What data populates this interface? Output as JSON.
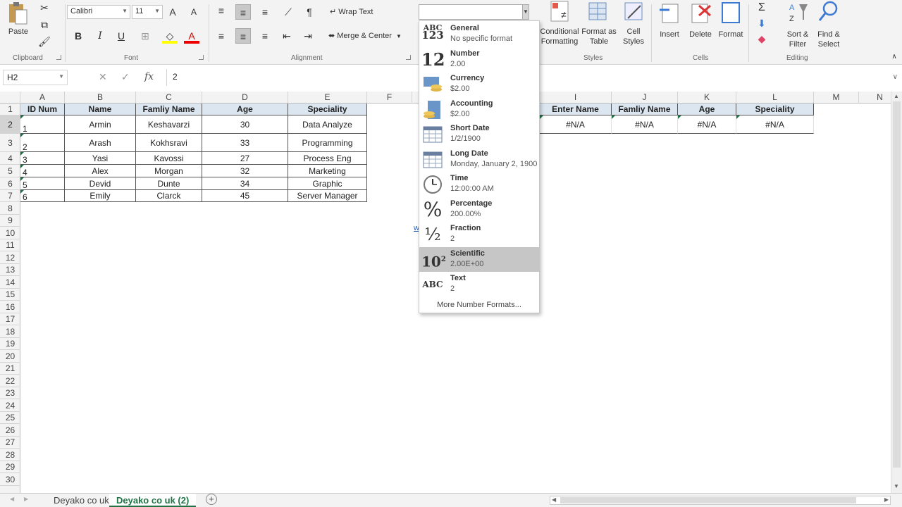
{
  "ribbon": {
    "clipboard": {
      "paste": "Paste",
      "label": "Clipboard"
    },
    "font": {
      "name": "Calibri",
      "size": "11",
      "label": "Font",
      "bold": "B",
      "italic": "I",
      "underline": "U",
      "grow": "A",
      "shrink": "A",
      "font_color_glyph": "A"
    },
    "alignment": {
      "wrap_text": "Wrap Text",
      "merge_center": "Merge & Center",
      "label": "Alignment"
    },
    "styles": {
      "conditional": "Conditional",
      "formatting": "Formatting",
      "format_as": "Format as",
      "table": "Table",
      "cell": "Cell",
      "cell_styles": "Styles",
      "label": "Styles"
    },
    "cells": {
      "insert": "Insert",
      "delete": "Delete",
      "format": "Format",
      "label": "Cells"
    },
    "editing": {
      "sort": "Sort &",
      "filter": "Filter",
      "find": "Find &",
      "select": "Select",
      "label": "Editing",
      "sigma": "Σ"
    }
  },
  "formula_bar": {
    "name_box": "H2",
    "fx": "fx",
    "value": "2"
  },
  "columns": [
    {
      "id": "A"
    },
    {
      "id": "B"
    },
    {
      "id": "C"
    },
    {
      "id": "D"
    },
    {
      "id": "E"
    },
    {
      "id": "F"
    },
    {
      "id": "I"
    },
    {
      "id": "J"
    },
    {
      "id": "K"
    },
    {
      "id": "L"
    },
    {
      "id": "M"
    },
    {
      "id": "N"
    }
  ],
  "rows": [
    "1",
    "2",
    "3",
    "4",
    "5",
    "6",
    "7",
    "8",
    "9",
    "10",
    "11",
    "12",
    "13",
    "14",
    "15",
    "16",
    "17",
    "18",
    "19",
    "20",
    "21",
    "22",
    "23",
    "24",
    "25",
    "26",
    "27",
    "28",
    "29",
    "30"
  ],
  "table": {
    "headers": [
      "ID Num",
      "Name",
      "Famliy Name",
      "Age",
      "Speciality"
    ],
    "rows": [
      [
        "1",
        "Armin",
        "Keshavarzi",
        "30",
        "Data Analyze"
      ],
      [
        "2",
        "Arash",
        "Kokhsravi",
        "33",
        "Programming"
      ],
      [
        "3",
        "Yasi",
        "Kavossi",
        "27",
        "Process Eng"
      ],
      [
        "4",
        "Alex",
        "Morgan",
        "32",
        "Marketing"
      ],
      [
        "5",
        "Devid",
        "Dunte",
        "34",
        "Graphic"
      ],
      [
        "6",
        "Emily",
        "Clarck",
        "45",
        "Server Manager"
      ]
    ]
  },
  "lookup": {
    "headers": [
      "Enter Name",
      "Famliy Name",
      "Age",
      "Speciality"
    ],
    "values": [
      "#N/A",
      "#N/A",
      "#N/A",
      "#N/A"
    ]
  },
  "partial_link": "w",
  "number_format_dropdown": {
    "items": [
      {
        "name": "General",
        "example": "No specific format",
        "icon": "abc-123-icon"
      },
      {
        "name": "Number",
        "example": "2.00",
        "icon": "number-12-icon"
      },
      {
        "name": "Currency",
        "example": "$2.00",
        "icon": "currency-icon"
      },
      {
        "name": "Accounting",
        "example": " $2.00",
        "icon": "accounting-icon"
      },
      {
        "name": "Short Date",
        "example": "1/2/1900",
        "icon": "calendar-icon"
      },
      {
        "name": "Long Date",
        "example": "Monday, January 2, 1900",
        "icon": "calendar-icon"
      },
      {
        "name": "Time",
        "example": "12:00:00 AM",
        "icon": "clock-icon"
      },
      {
        "name": "Percentage",
        "example": "200.00%",
        "icon": "percent-icon"
      },
      {
        "name": "Fraction",
        "example": "2",
        "icon": "fraction-icon"
      },
      {
        "name": "Scientific",
        "example": "2.00E+00",
        "icon": "scientific-icon"
      },
      {
        "name": "Text",
        "example": "2",
        "icon": "abc-text-icon"
      }
    ],
    "hovered": "Scientific",
    "more": "More Number Formats..."
  },
  "sheets": {
    "tabs": [
      "Deyako co uk",
      "Deyako co uk (2)"
    ],
    "active": "Deyako co uk (2)"
  },
  "colors": {
    "header_fill": "#dce6f1",
    "accent": "#217346",
    "hover": "#c6c6c6"
  }
}
